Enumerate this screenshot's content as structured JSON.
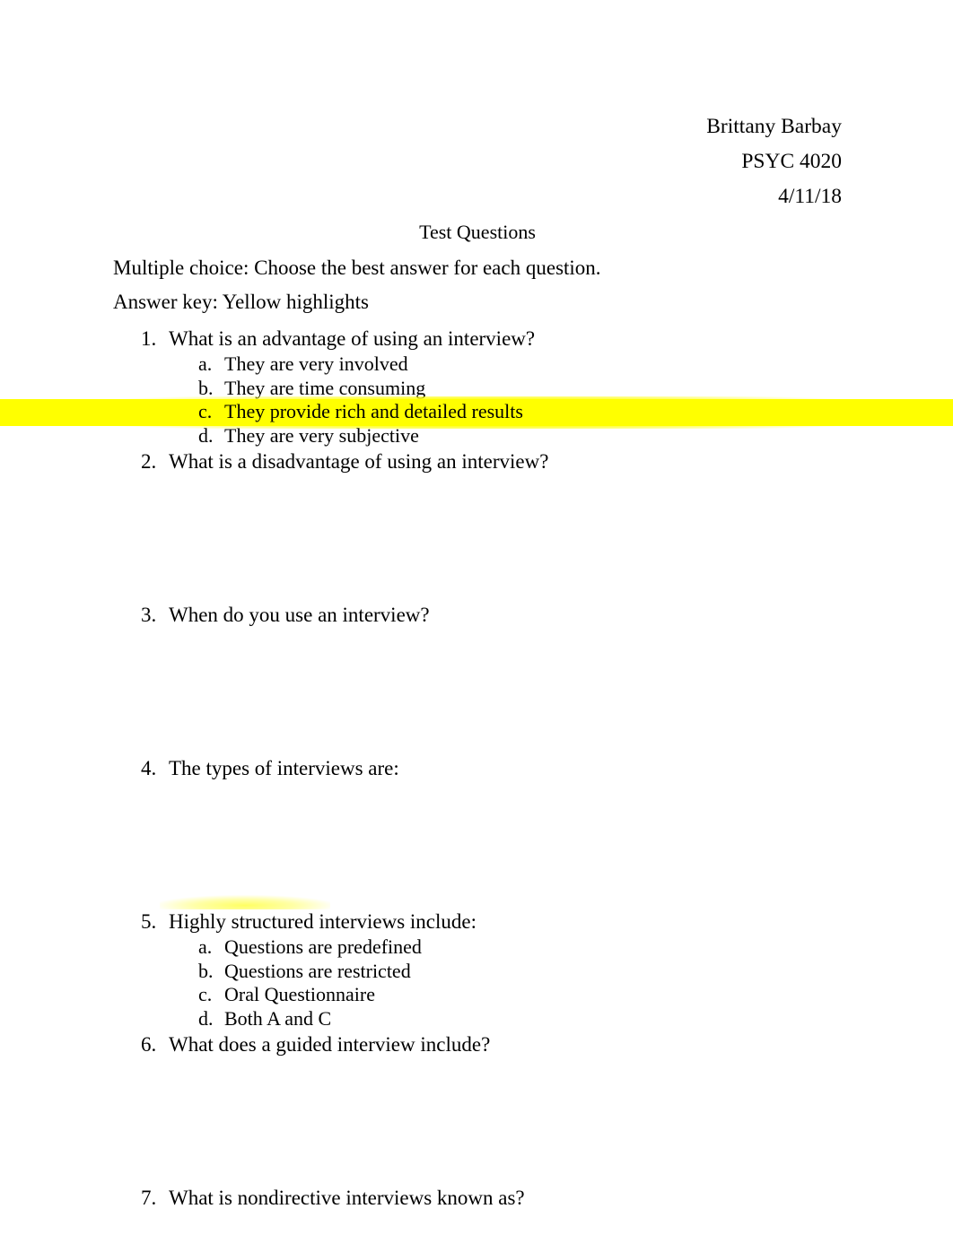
{
  "document": {
    "header_lines": [
      "Brittany Barbay",
      "PSYC 4020",
      "4/11/18"
    ],
    "title": "Test Questions",
    "instructions": "Multiple choice: Choose the best answer for each question.",
    "answer_key_note": "Answer key: Yellow highlights",
    "highlight_color": "#ffff00"
  },
  "questions": [
    {
      "number": "1.",
      "text": "What is an advantage of using an interview?",
      "options": [
        {
          "letter": "a.",
          "text": "They are very involved",
          "highlighted": false
        },
        {
          "letter": "b.",
          "text": "They are time consuming",
          "highlighted": false
        },
        {
          "letter": "c.",
          "text": "They provide rich and detailed results",
          "highlighted": true
        },
        {
          "letter": "d.",
          "text": "They are very subjective",
          "highlighted": false
        }
      ]
    },
    {
      "number": "2.",
      "text": "What is a disadvantage of using an interview?",
      "options": []
    },
    {
      "number": "3.",
      "text": "When do you use an interview?",
      "options": []
    },
    {
      "number": "4.",
      "text": "The types of interviews are:",
      "options": []
    },
    {
      "number": "5.",
      "text": "Highly structured interviews include:",
      "options": [
        {
          "letter": "a.",
          "text": "Questions are predefined",
          "highlighted": false
        },
        {
          "letter": "b.",
          "text": "Questions are restricted",
          "highlighted": false
        },
        {
          "letter": "c.",
          "text": "Oral Questionnaire",
          "highlighted": false
        },
        {
          "letter": "d.",
          "text": "Both A and C",
          "highlighted": false
        }
      ]
    },
    {
      "number": "6.",
      "text": "What does a guided interview include?",
      "options": []
    },
    {
      "number": "7.",
      "text": "What is nondirective interviews known as?",
      "options": []
    }
  ]
}
